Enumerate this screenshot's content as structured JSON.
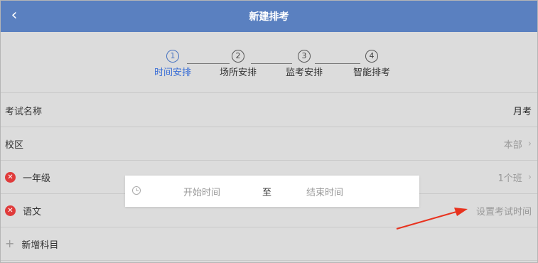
{
  "header": {
    "back_icon": "chevron-left-icon",
    "title": "新建排考",
    "color": "#5a80c0"
  },
  "steps": [
    {
      "num": "1",
      "label": "时间安排",
      "active": true
    },
    {
      "num": "2",
      "label": "场所安排",
      "active": false
    },
    {
      "num": "3",
      "label": "监考安排",
      "active": false
    },
    {
      "num": "4",
      "label": "智能排考",
      "active": false
    }
  ],
  "form": {
    "exam_name_label": "考试名称",
    "exam_name_value": "月考",
    "campus_label": "校区",
    "campus_value": "本部",
    "grade_label": "一年级",
    "grade_value": "1个班",
    "subject_label": "语文",
    "subject_action": "设置考试时间",
    "add_subject_label": "新增科目"
  },
  "time_picker": {
    "start_placeholder": "开始时间",
    "separator": "至",
    "end_placeholder": "结束时间"
  },
  "colors": {
    "accent": "#3b6fd6",
    "danger": "#e03b3b",
    "annotation_arrow": "#e8321e"
  }
}
